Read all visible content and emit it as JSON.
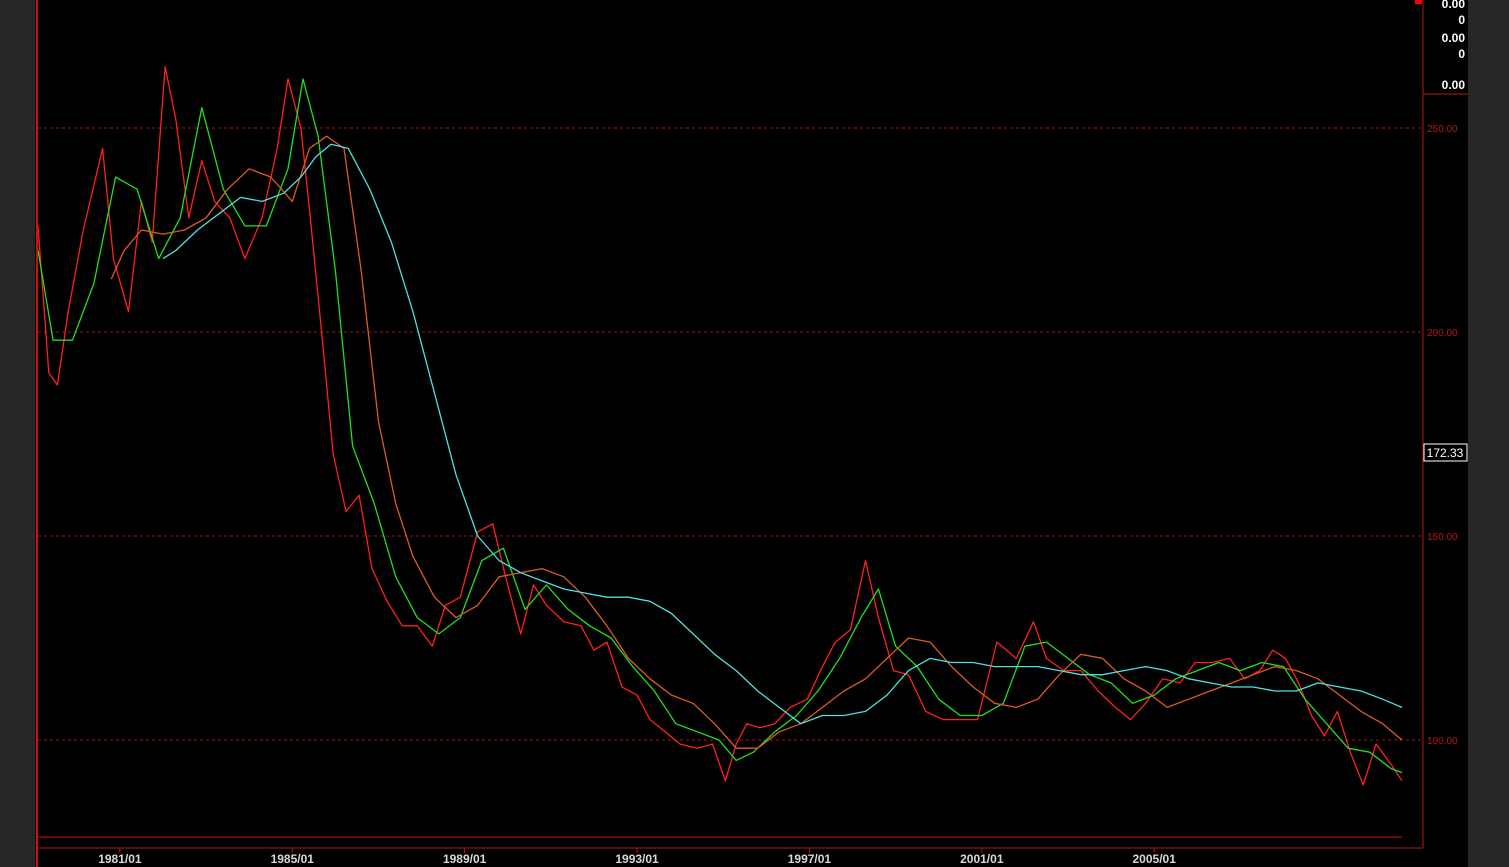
{
  "indicator_panel": {
    "values": [
      "0.00",
      "0",
      "0.00",
      "0",
      "0.00"
    ]
  },
  "last_price_label": "172.33",
  "chart_data": {
    "type": "line",
    "title": "",
    "xlabel": "",
    "ylabel": "",
    "ylim": [
      80,
      280
    ],
    "y_ticks": [
      "250.00",
      "200.00",
      "150.00",
      "100.00"
    ],
    "x_ticks": [
      "1981/01",
      "1985/01",
      "1989/01",
      "1993/01",
      "1997/01",
      "2001/01",
      "2005/01"
    ],
    "grid": "horizontal dashed",
    "last_value": 172.33,
    "x_range": [
      1979.1,
      2010.75
    ],
    "series": [
      {
        "color": "#ff2020",
        "x": [
          1979.1,
          1979.35,
          1979.55,
          1979.8,
          1980.15,
          1980.6,
          1980.85,
          1981.2,
          1981.5,
          1981.75,
          1982.05,
          1982.3,
          1982.6,
          1982.9,
          1983.2,
          1983.55,
          1983.9,
          1984.3,
          1984.65,
          1984.9,
          1985.2,
          1985.4,
          1985.7,
          1985.95,
          1986.25,
          1986.55,
          1986.85,
          1987.2,
          1987.55,
          1987.9,
          1988.25,
          1988.55,
          1988.9,
          1989.3,
          1989.65,
          1989.95,
          1990.3,
          1990.6,
          1990.9,
          1991.3,
          1991.7,
          1992.0,
          1992.3,
          1992.65,
          1993.0,
          1993.3,
          1993.65,
          1994.0,
          1994.4,
          1994.75,
          1995.05,
          1995.3,
          1995.55,
          1995.85,
          1996.2,
          1996.55,
          1996.95,
          1997.3,
          1997.6,
          1997.95,
          1998.3,
          1998.6,
          1998.95,
          1999.3,
          1999.7,
          2000.1,
          2000.5,
          2000.9,
          2001.35,
          2001.8,
          2002.2,
          2002.5,
          2002.9,
          2003.3,
          2003.7,
          2004.1,
          2004.45,
          2004.8,
          2005.2,
          2005.6,
          2005.95,
          2006.35,
          2006.75,
          2007.1,
          2007.45,
          2007.75,
          2008.05,
          2008.35,
          2008.65,
          2008.95,
          2009.25,
          2009.55,
          2009.85,
          2010.15,
          2010.5,
          2010.75
        ],
        "values": [
          226,
          190,
          187,
          205,
          225,
          245,
          218,
          205,
          232,
          222,
          265,
          252,
          228,
          242,
          232,
          228,
          218,
          228,
          245,
          262,
          250,
          230,
          198,
          170,
          156,
          160,
          142,
          134,
          128,
          128,
          123,
          133,
          135,
          151,
          153,
          140,
          126,
          138,
          133,
          129,
          128,
          122,
          124,
          113,
          111,
          105,
          102,
          99,
          98,
          99,
          90,
          99,
          104,
          103,
          104,
          108,
          110,
          118,
          124,
          127,
          144,
          130,
          117,
          116,
          107,
          105,
          105,
          105,
          124,
          120,
          129,
          120,
          117,
          117,
          112,
          108,
          105,
          109,
          115,
          114,
          119,
          119,
          120,
          115,
          117,
          122,
          120,
          114,
          106,
          101,
          107,
          97,
          89,
          99,
          94,
          90
        ]
      },
      {
        "color": "#20e020",
        "x": [
          1979.1,
          1979.45,
          1979.9,
          1980.4,
          1980.9,
          1981.4,
          1981.9,
          1982.4,
          1982.9,
          1983.4,
          1983.9,
          1984.4,
          1984.9,
          1985.25,
          1985.6,
          1986.0,
          1986.4,
          1986.9,
          1987.4,
          1987.9,
          1988.4,
          1988.9,
          1989.4,
          1989.9,
          1990.4,
          1990.9,
          1991.4,
          1991.9,
          1992.4,
          1992.9,
          1993.4,
          1993.9,
          1994.4,
          1994.9,
          1995.3,
          1995.7,
          1996.2,
          1996.7,
          1997.2,
          1997.7,
          1998.2,
          1998.6,
          1999.0,
          1999.5,
          2000.0,
          2000.5,
          2001.0,
          2001.5,
          2002.0,
          2002.5,
          2003.0,
          2003.5,
          2004.0,
          2004.5,
          2005.0,
          2005.5,
          2006.0,
          2006.5,
          2007.0,
          2007.5,
          2008.0,
          2008.5,
          2009.0,
          2009.5,
          2010.0,
          2010.5,
          2010.75
        ],
        "values": [
          220,
          198,
          198,
          212,
          238,
          235,
          218,
          228,
          255,
          235,
          226,
          226,
          240,
          262,
          248,
          215,
          172,
          158,
          140,
          130,
          126,
          130,
          144,
          147,
          132,
          138,
          132,
          128,
          125,
          118,
          112,
          104,
          102,
          100,
          95,
          97,
          102,
          106,
          112,
          120,
          130,
          137,
          123,
          118,
          110,
          106,
          106,
          109,
          123,
          124,
          120,
          116,
          114,
          109,
          111,
          115,
          117,
          119,
          117,
          119,
          118,
          110,
          104,
          98,
          97,
          93,
          92
        ]
      },
      {
        "color": "#e05a20",
        "x": [
          1980.8,
          1981.1,
          1981.5,
          1982.0,
          1982.5,
          1983.0,
          1983.5,
          1984.0,
          1984.5,
          1985.0,
          1985.4,
          1985.8,
          1986.2,
          1986.6,
          1987.0,
          1987.4,
          1987.8,
          1988.3,
          1988.8,
          1989.3,
          1989.8,
          1990.3,
          1990.8,
          1991.3,
          1991.8,
          1992.3,
          1992.8,
          1993.3,
          1993.8,
          1994.3,
          1994.8,
          1995.3,
          1995.8,
          1996.3,
          1996.8,
          1997.3,
          1997.8,
          1998.3,
          1998.8,
          1999.3,
          1999.8,
          2000.3,
          2000.8,
          2001.3,
          2001.8,
          2002.3,
          2002.8,
          2003.3,
          2003.8,
          2004.3,
          2004.8,
          2005.3,
          2005.8,
          2006.3,
          2006.8,
          2007.3,
          2007.8,
          2008.3,
          2008.8,
          2009.3,
          2009.8,
          2010.3,
          2010.75
        ],
        "values": [
          213,
          220,
          225,
          224,
          225,
          228,
          235,
          240,
          238,
          232,
          245,
          248,
          245,
          215,
          178,
          158,
          145,
          135,
          130,
          133,
          140,
          141,
          142,
          140,
          135,
          128,
          120,
          115,
          111,
          109,
          104,
          98,
          98,
          102,
          104,
          108,
          112,
          115,
          120,
          125,
          124,
          118,
          113,
          109,
          108,
          110,
          116,
          121,
          120,
          115,
          112,
          108,
          110,
          112,
          114,
          116,
          118,
          117,
          115,
          111,
          107,
          104,
          100
        ]
      },
      {
        "color": "#50e0e0",
        "x": [
          1982.0,
          1982.3,
          1982.8,
          1983.3,
          1983.8,
          1984.3,
          1984.8,
          1985.2,
          1985.55,
          1985.9,
          1986.3,
          1986.8,
          1987.3,
          1987.8,
          1988.3,
          1988.8,
          1989.3,
          1989.8,
          1990.3,
          1990.8,
          1991.3,
          1991.8,
          1992.3,
          1992.8,
          1993.3,
          1993.8,
          1994.3,
          1994.8,
          1995.3,
          1995.8,
          1996.3,
          1996.8,
          1997.3,
          1997.8,
          1998.3,
          1998.8,
          1999.3,
          1999.8,
          2000.3,
          2000.8,
          2001.3,
          2001.8,
          2002.3,
          2002.8,
          2003.3,
          2003.8,
          2004.3,
          2004.8,
          2005.3,
          2005.8,
          2006.3,
          2006.8,
          2007.3,
          2007.8,
          2008.3,
          2008.8,
          2009.3,
          2009.8,
          2010.3,
          2010.75
        ],
        "values": [
          218,
          220,
          225,
          229,
          233,
          232,
          234,
          238,
          243,
          246,
          245,
          235,
          222,
          205,
          185,
          165,
          150,
          144,
          141,
          139,
          137,
          136,
          135,
          135,
          134,
          131,
          126,
          121,
          117,
          112,
          108,
          104,
          106,
          106,
          107,
          111,
          117,
          120,
          119,
          119,
          118,
          118,
          118,
          117,
          116,
          116,
          117,
          118,
          117,
          115,
          114,
          113,
          113,
          112,
          112,
          114,
          113,
          112,
          110,
          108
        ]
      }
    ]
  }
}
